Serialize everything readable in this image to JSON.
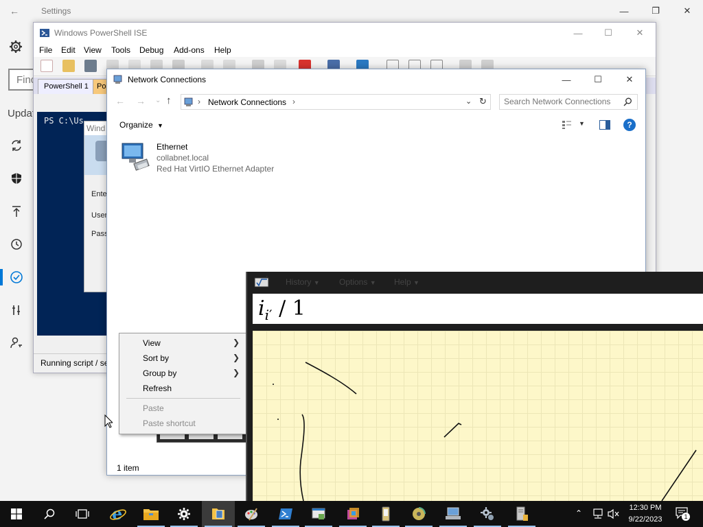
{
  "settings": {
    "title": "Settings",
    "search_placeholder": "Find",
    "section_label": "Updat"
  },
  "ise": {
    "title": "Windows PowerShell ISE",
    "menu": [
      "File",
      "Edit",
      "View",
      "Tools",
      "Debug",
      "Add-ons",
      "Help"
    ],
    "tabs": [
      "PowerShell 1",
      "Po"
    ],
    "console_text": "PS C:\\Us",
    "status_text": "Running script / se"
  },
  "credential_dialog": {
    "title": "Wind",
    "labels": [
      "Ente",
      "User",
      "Pass"
    ]
  },
  "network_connections": {
    "title": "Network Connections",
    "breadcrumb": "Network Connections",
    "search_placeholder": "Search Network Connections",
    "organize_label": "Organize",
    "item": {
      "name": "Ethernet",
      "network": "collabnet.local",
      "adapter": "Red Hat VirtIO Ethernet Adapter"
    },
    "status": "1 item"
  },
  "context_menu": {
    "items": [
      {
        "label": "View",
        "submenu": true,
        "enabled": true
      },
      {
        "label": "Sort by",
        "submenu": true,
        "enabled": true
      },
      {
        "label": "Group by",
        "submenu": true,
        "enabled": true
      },
      {
        "label": "Refresh",
        "submenu": false,
        "enabled": true
      },
      {
        "label": "Paste",
        "submenu": false,
        "enabled": false
      },
      {
        "label": "Paste shortcut",
        "submenu": false,
        "enabled": false
      }
    ]
  },
  "math_input_panel": {
    "menu": [
      "History",
      "Options",
      "Help"
    ],
    "preview_base": "i",
    "preview_sub": "i",
    "preview_prime": "′",
    "preview_rest": "/ 1"
  },
  "taskbar": {
    "time": "12:30 PM",
    "date": "9/22/2023",
    "notification_count": "1"
  },
  "colors": {
    "accent": "#0078d7",
    "powershell_bg": "#012456",
    "math_pad": "#fdf7c9",
    "taskbar": "#101010"
  }
}
